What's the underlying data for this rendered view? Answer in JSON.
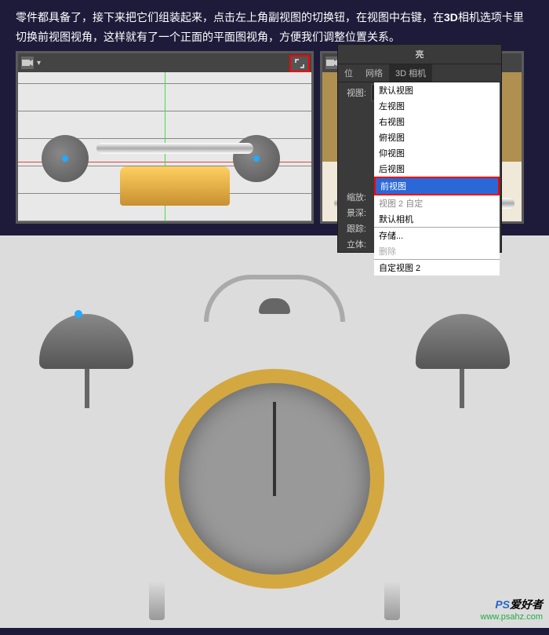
{
  "instruction": {
    "line1_pre": "零件都具备了，接下来把它们组装起来，点击左上角副视图的切换钮，在视图中右键，在",
    "line1_accent": "3D",
    "line1_post": "相机选项卡里切换前视图视角，这样就有了一个正面的平面图视角，方便我们调整位置关系。"
  },
  "context_menu": {
    "title": "亮",
    "tabs": {
      "t1": "位",
      "t2": "网络",
      "t3": "3D 相机"
    },
    "rows": {
      "view_label": "视图:",
      "view_value": "自定视图 2",
      "zoom_label": "缩放:",
      "depth_label": "景深:",
      "track_label": "跟踪:",
      "stereo_label": "立体:"
    },
    "options": {
      "o1": "默认视图",
      "o2": "左视图",
      "o3": "右视图",
      "o4": "俯视图",
      "o5": "仰视图",
      "o6": "后视图",
      "o7": "前视图",
      "o8": "默认相机",
      "o8b": "视图 2 自定",
      "o9": "存储...",
      "o10": "删除",
      "o11": "自定视图 2"
    }
  },
  "watermark": {
    "brand_pre": "PS",
    "brand_post": "爱好者",
    "url": "www.psahz.com"
  }
}
